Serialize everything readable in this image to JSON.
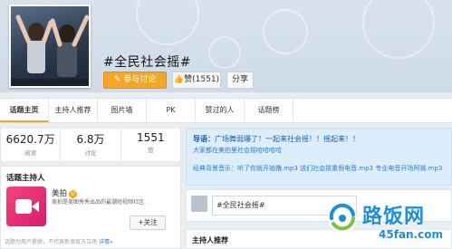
{
  "header": {
    "topic_title": "#全民社会摇#",
    "join_label": "参与讨论",
    "like_label": "赞(1551)",
    "share_label": "分享"
  },
  "tabs": [
    "话题主页",
    "主持人推荐",
    "图片墙",
    "PK",
    "赞过的人",
    "话题榜"
  ],
  "stats": [
    {
      "value": "6620.7万",
      "label": "阅读"
    },
    {
      "value": "6.8万",
      "label": "讨论"
    },
    {
      "value": "1551",
      "label": "赞"
    }
  ],
  "host": {
    "heading": "话题主持人",
    "name": "美拍",
    "verified_glyph": "V",
    "description": "美拍是美图秀秀出品的最潮短视频社区.",
    "follow_label": "+关注",
    "footer_text": "话题为用户提供，不代表新浪官方立场",
    "footer_link": "详情»"
  },
  "guide": {
    "lead": "导语：",
    "line1": "广场舞弱爆了！一起来社会摇！！摇起来！！",
    "line2": "大家都在美拍里社会摇哈哈哈哈",
    "line3": "经典背景音乐：听了你就开始撸.mp3 送们社会摇重频电音.mp3 专业电音开场阿锡.mp3"
  },
  "post": {
    "input_value": "#全民社会摇#"
  },
  "recommend": {
    "heading": "主持人推荐"
  },
  "watermark": {
    "cn": "路饭网",
    "en": "45fan.com"
  },
  "colors": {
    "accent": "#f5a623",
    "link": "#3a75c4",
    "guide_bg": "#dceefb",
    "watermark": "#1a8fe0"
  }
}
